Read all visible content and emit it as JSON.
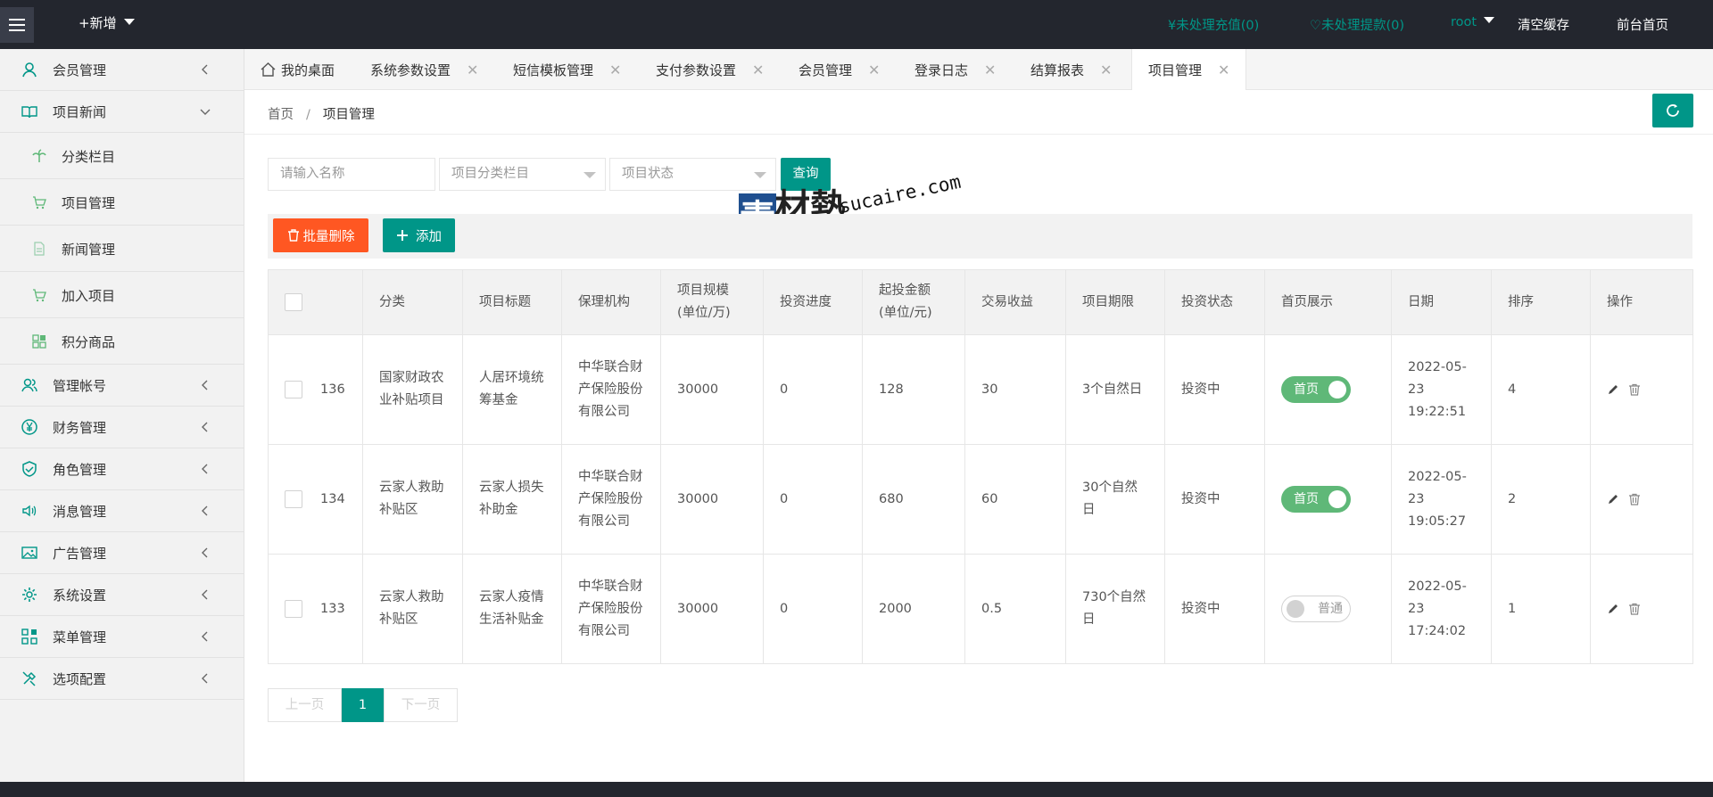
{
  "topbar": {
    "new_label": "+新增",
    "pending_recharge": "¥未处理充值(0)",
    "pending_withdraw": "♡未处理提款(0)",
    "user": "root",
    "clear_cache": "清空缓存",
    "front_home": "前台首页"
  },
  "sidebar": {
    "items": [
      {
        "label": "会员管理",
        "icon": "user-icon"
      },
      {
        "label": "项目新闻",
        "icon": "book-icon",
        "expanded": true
      },
      {
        "label": "分类栏目",
        "icon": "palm-icon",
        "sub": true
      },
      {
        "label": "项目管理",
        "icon": "cart-icon",
        "sub": true
      },
      {
        "label": "新闻管理",
        "icon": "file-icon",
        "sub": true
      },
      {
        "label": "加入项目",
        "icon": "cart-icon",
        "sub": true
      },
      {
        "label": "积分商品",
        "icon": "grid-icon",
        "sub": true
      },
      {
        "label": "管理帐号",
        "icon": "users-icon"
      },
      {
        "label": "财务管理",
        "icon": "yen-icon"
      },
      {
        "label": "角色管理",
        "icon": "shield-icon"
      },
      {
        "label": "消息管理",
        "icon": "speaker-icon"
      },
      {
        "label": "广告管理",
        "icon": "picture-icon"
      },
      {
        "label": "系统设置",
        "icon": "gear-icon"
      },
      {
        "label": "菜单管理",
        "icon": "app-grid-icon"
      },
      {
        "label": "选项配置",
        "icon": "tools-icon"
      }
    ]
  },
  "tabs": [
    {
      "label": "我的桌面",
      "closable": false
    },
    {
      "label": "系统参数设置",
      "closable": true
    },
    {
      "label": "短信模板管理",
      "closable": true
    },
    {
      "label": "支付参数设置",
      "closable": true
    },
    {
      "label": "会员管理",
      "closable": true
    },
    {
      "label": "登录日志",
      "closable": true
    },
    {
      "label": "结算报表",
      "closable": true
    },
    {
      "label": "项目管理",
      "closable": true,
      "active": true
    }
  ],
  "breadcrumb": {
    "home": "首页",
    "sep": "/",
    "current": "项目管理"
  },
  "search": {
    "name_placeholder": "请输入名称",
    "category_placeholder": "项目分类栏目",
    "status_placeholder": "项目状态",
    "query_label": "查询"
  },
  "toolbar": {
    "batch_delete": "批量删除",
    "add": "添加"
  },
  "table": {
    "headers": [
      "分类",
      "项目标题",
      "保理机构",
      "项目规模\n(单位/万)",
      "投资进度",
      "起投金额\n(单位/元)",
      "交易收益",
      "项目期限",
      "投资状态",
      "首页展示",
      "日期",
      "排序",
      "操作"
    ],
    "header_lines": {
      "scale_1": "项目规模",
      "scale_2": "(单位/万)",
      "min_1": "起投金额",
      "min_2": "(单位/元)"
    },
    "rows": [
      {
        "id": "136",
        "category": "国家财政农业补贴项目",
        "title": "人居环境统筹基金",
        "org": "中华联合财产保险股份有限公司",
        "scale": "30000",
        "progress": "0",
        "min": "128",
        "profit": "30",
        "term": "3个自然日",
        "status": "投资中",
        "home": "首页",
        "home_on": true,
        "date": "2022-05-23 19:22:51",
        "sort": "4"
      },
      {
        "id": "134",
        "category": "云家人救助补贴区",
        "title": "云家人损失补助金",
        "org": "中华联合财产保险股份有限公司",
        "scale": "30000",
        "progress": "0",
        "min": "680",
        "profit": "60",
        "term": "30个自然日",
        "status": "投资中",
        "home": "首页",
        "home_on": true,
        "date": "2022-05-23 19:05:27",
        "sort": "2"
      },
      {
        "id": "133",
        "category": "云家人救助补贴区",
        "title": "云家人疫情生活补贴金",
        "org": "中华联合财产保险股份有限公司",
        "scale": "30000",
        "progress": "0",
        "min": "2000",
        "profit": "0.5",
        "term": "730个自然日",
        "status": "投资中",
        "home": "普通",
        "home_on": false,
        "date": "2022-05-23 17:24:02",
        "sort": "1"
      }
    ]
  },
  "pager": {
    "prev": "上一页",
    "current": "1",
    "next": "下一页"
  },
  "watermark": {
    "cn_1": "素",
    "cn_2": "材熱",
    "en": "sucaire.com"
  },
  "colors": {
    "primary": "#009688",
    "danger": "#ff5722",
    "topbar": "#23262e",
    "switch_on": "#5fb878"
  }
}
